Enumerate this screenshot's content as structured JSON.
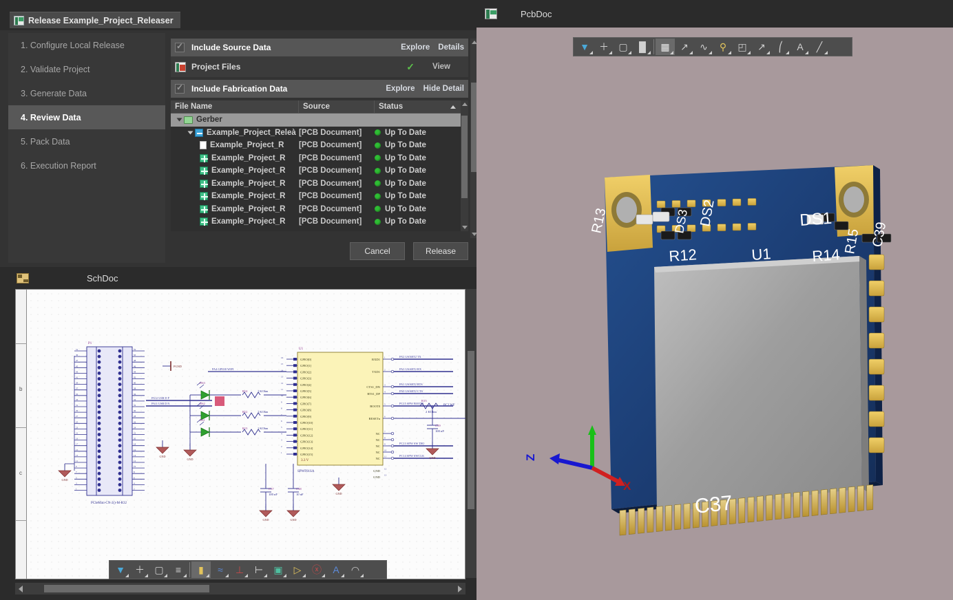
{
  "release_dialog": {
    "tab_title": "Release Example_Project_Releaser",
    "steps": [
      {
        "label": "1. Configure Local Release",
        "active": false
      },
      {
        "label": "2. Validate Project",
        "active": false
      },
      {
        "label": "3. Generate Data",
        "active": false
      },
      {
        "label": "4. Review Data",
        "active": true
      },
      {
        "label": "5. Pack Data",
        "active": false
      },
      {
        "label": "6. Execution Report",
        "active": false
      }
    ],
    "sections": [
      {
        "title": "Include Source Data",
        "checked": true,
        "links": [
          "Explore",
          "Details"
        ]
      },
      {
        "title": "Include Fabrication Data",
        "checked": true,
        "links": [
          "Explore",
          "Hide Detail"
        ]
      }
    ],
    "project_files_row": {
      "label": "Project Files",
      "status_tick": "✓",
      "action": "View"
    },
    "table": {
      "columns": [
        "File Name",
        "Source",
        "Status"
      ],
      "sort_column": "Status",
      "sort_direction": "ascending",
      "rows": [
        {
          "name": "Gerber",
          "source": "",
          "status": "",
          "icon": "folder-icon",
          "depth": 0,
          "expanded": true,
          "selected": true
        },
        {
          "name": "Example_Project_Releà",
          "source": "[PCB Document]",
          "status": "Up To Date",
          "icon": "pcb-document-icon",
          "depth": 1,
          "expanded": true,
          "selected": false
        },
        {
          "name": "Example_Project_R",
          "source": "[PCB Document]",
          "status": "Up To Date",
          "icon": "page-icon",
          "depth": 2,
          "expanded": false,
          "selected": false
        },
        {
          "name": "Example_Project_R",
          "source": "[PCB Document]",
          "status": "Up To Date",
          "icon": "gerber-icon",
          "depth": 2,
          "expanded": false,
          "selected": false
        },
        {
          "name": "Example_Project_R",
          "source": "[PCB Document]",
          "status": "Up To Date",
          "icon": "gerber-icon",
          "depth": 2,
          "expanded": false,
          "selected": false
        },
        {
          "name": "Example_Project_R",
          "source": "[PCB Document]",
          "status": "Up To Date",
          "icon": "gerber-icon",
          "depth": 2,
          "expanded": false,
          "selected": false
        },
        {
          "name": "Example_Project_R",
          "source": "[PCB Document]",
          "status": "Up To Date",
          "icon": "gerber-icon",
          "depth": 2,
          "expanded": false,
          "selected": false
        },
        {
          "name": "Example_Project_R",
          "source": "[PCB Document]",
          "status": "Up To Date",
          "icon": "gerber-icon",
          "depth": 2,
          "expanded": false,
          "selected": false
        },
        {
          "name": "Example_Project_R",
          "source": "[PCB Document]",
          "status": "Up To Date",
          "icon": "gerber-icon",
          "depth": 2,
          "expanded": false,
          "selected": false
        }
      ]
    },
    "buttons": {
      "cancel": "Cancel",
      "release": "Release"
    }
  },
  "schdoc_panel": {
    "title": "SchDoc",
    "toolbar": [
      {
        "name": "filter-icon",
        "glyph": "▼",
        "color": "#4aa8d8",
        "selected": false
      },
      {
        "name": "crosshair-icon",
        "glyph": "＋",
        "color": "#cfcfcf",
        "selected": false
      },
      {
        "name": "marquee-select-icon",
        "glyph": "▢",
        "color": "#cfcfcf",
        "selected": false
      },
      {
        "name": "align-icon",
        "glyph": "≡",
        "color": "#cfcfcf",
        "selected": false
      },
      {
        "name": "place-component-icon",
        "glyph": "▮",
        "color": "#e3c45c",
        "selected": true
      },
      {
        "name": "place-wire-icon",
        "glyph": "≈",
        "color": "#5c8ad8",
        "selected": false
      },
      {
        "name": "place-gnd-icon",
        "glyph": "⊥",
        "color": "#c44a4a",
        "selected": false
      },
      {
        "name": "place-port-icon",
        "glyph": "⊢",
        "color": "#dcdcdc",
        "selected": false
      },
      {
        "name": "place-sheet-symbol-icon",
        "glyph": "▣",
        "color": "#4fbfa0",
        "selected": false
      },
      {
        "name": "place-sheet-entry-icon",
        "glyph": "▷",
        "color": "#e3c45c",
        "selected": false
      },
      {
        "name": "place-no-erc-icon",
        "glyph": "ⓧ",
        "color": "#c44a4a",
        "selected": false
      },
      {
        "name": "place-text-icon",
        "glyph": "A",
        "color": "#5c8ad8",
        "selected": false
      },
      {
        "name": "place-arc-icon",
        "glyph": "◠",
        "color": "#cfcfcf",
        "selected": false
      }
    ],
    "sheet_zone_labels": [
      "b",
      "c"
    ],
    "schematic": {
      "connector": {
        "designator": "P1",
        "part_number": "PCIeMini-CN-2()-M-R32",
        "pin_count": 52
      },
      "ic": {
        "designator": "U1",
        "part_number": "SPWF01SA",
        "power_pin_label": "3.3 V",
        "left_pins": [
          "GPIO[0]",
          "GPIO[1]",
          "GPIO[2]",
          "GPIO[3]",
          "GPIO[4]",
          "GPIO[5]",
          "GPIO[6]",
          "GPIO[7]",
          "GPIO[8]",
          "GPIO[9]",
          "GPIO[10]",
          "GPIO[11]",
          "GPIO[12]",
          "GPIO[13]",
          "GPIO[14]",
          "GPIO[15]"
        ],
        "right_pins": [
          "RXD1",
          "TXD1",
          "CTS1_DN",
          "RTS1_DP",
          "BOOT0",
          "RESETn",
          "NC",
          "NC",
          "NC",
          "NC",
          "NC",
          "GND",
          "GND"
        ]
      },
      "net_labels": [
        "PA2 USART2 TX",
        "PA3 USART2 RX",
        "PA1 USART2 RTS",
        "PA0 USART2 CTS",
        "PC15 SPW BOOT0",
        "PC13 SPW SW DIO",
        "PC14 SPW SWCLK",
        "PA12 USB D P",
        "PA11 USB D N",
        "PA4 GPIO0 WIFI",
        "PC2 WF"
      ],
      "leds": [
        "DS1",
        "DS2",
        "DS3"
      ],
      "resistors": [
        {
          "designator": "R14",
          "value": "1 KOhm"
        },
        {
          "designator": "R12",
          "value": "1 KOhm"
        },
        {
          "designator": "R13",
          "value": "1 KOhm"
        },
        {
          "designator": "R15",
          "value": "2 KOhm"
        }
      ],
      "capacitors": [
        {
          "designator": "C37",
          "value": "100 nF"
        },
        {
          "designator": "C38",
          "value": "10 nF"
        },
        {
          "designator": "C39",
          "value": "100 nF"
        }
      ],
      "power_ports": [
        "GND",
        "PGND"
      ]
    }
  },
  "pcbdoc_panel": {
    "title": "PcbDoc",
    "toolbar": [
      {
        "name": "filter-icon",
        "glyph": "▼",
        "color": "#4aa8d8",
        "selected": false
      },
      {
        "name": "crosshair-icon",
        "glyph": "＋",
        "color": "#cfcfcf",
        "selected": false
      },
      {
        "name": "marquee-select-icon",
        "glyph": "▢",
        "color": "#cfcfcf",
        "selected": false
      },
      {
        "name": "layer-stack-icon",
        "glyph": "█",
        "color": "#cfcfcf",
        "selected": false
      },
      {
        "name": "place-component-icon",
        "glyph": "▦",
        "color": "#e9e9e9",
        "selected": true
      },
      {
        "name": "place-track-icon",
        "glyph": "↗",
        "color": "#cfcfcf",
        "selected": false
      },
      {
        "name": "place-arc-icon",
        "glyph": "∿",
        "color": "#cfcfcf",
        "selected": false
      },
      {
        "name": "place-pad-icon",
        "glyph": "⚲",
        "color": "#e3c45c",
        "selected": false
      },
      {
        "name": "place-fill-icon",
        "glyph": "◰",
        "color": "#cfcfcf",
        "selected": false
      },
      {
        "name": "place-dimension-icon",
        "glyph": "↗",
        "color": "#cfcfcf",
        "selected": false
      },
      {
        "name": "place-room-icon",
        "glyph": "⎛",
        "color": "#cfcfcf",
        "selected": false
      },
      {
        "name": "place-string-icon",
        "glyph": "A",
        "color": "#cfcfcf",
        "selected": false
      },
      {
        "name": "place-line-icon",
        "glyph": "╱",
        "color": "#cfcfcf",
        "selected": false
      }
    ],
    "board": {
      "silkscreen_designators": [
        "R13",
        "DS3",
        "DS2",
        "DS1",
        "R12",
        "U1",
        "R14",
        "R15",
        "C39",
        "C37"
      ],
      "board_color": "#1d3f7a",
      "pad_color": "#e0b84a",
      "shield_color": "#a6a6a6"
    },
    "axis_gizmo": {
      "x_label": "X",
      "x_color": "#d02020",
      "y_label": "",
      "y_color": "#18c018",
      "z_label": "Z",
      "z_color": "#1818d0"
    }
  }
}
